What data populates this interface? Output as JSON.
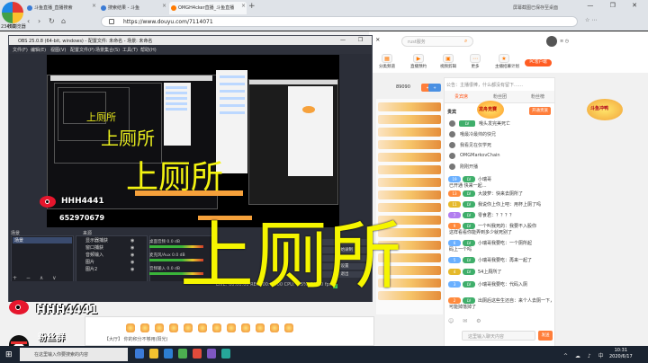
{
  "browser": {
    "logo_label": "2345浏览器",
    "tabs": [
      {
        "label": "斗鱼直播_直播搜索"
      },
      {
        "label": "搜索结果 - 斗鱼"
      },
      {
        "label": "OMGH4cker直播_斗鱼直播"
      }
    ],
    "tab_right": "屏幕截图已保存至桌面",
    "url": "https://www.douyu.com/7114071",
    "bookmark": "收藏"
  },
  "douyu": {
    "search_placeholder": "rust服务",
    "header_icons": [
      "分类",
      "直播",
      "视频",
      "更多",
      "娱乐"
    ],
    "header_icon_labels": [
      "分类频道",
      "直播预约",
      "视频剪辑",
      "更多",
      "主播招募计划"
    ],
    "pc_client": "PC客户端",
    "stream_stat": "89090",
    "widget_label": "龙舟竞赛",
    "right_banner": "斗鱼冲鸭",
    "chat_notice": "公告：主播很棒，什么都没有留下……",
    "chat_tabs": [
      "贵宾席",
      "粉丝团",
      "粉丝榜"
    ],
    "chat_open": "开通贵族",
    "chat_section": "贵宾",
    "fans": [
      {
        "level": "LV",
        "name": "哦头发完美死亡"
      },
      {
        "level": "",
        "name": "哦最冷最帅的快兄"
      },
      {
        "level": "",
        "name": "我看见在仅学死"
      },
      {
        "level": "",
        "name": "OMGMarkovChain"
      },
      {
        "level": "",
        "name": "刚刚开播"
      }
    ],
    "chat_lines": [
      {
        "b1": "19",
        "b2": "LV",
        "text": "小瑞哥",
        "cont": "已开通  快来一起…"
      },
      {
        "b1": "13",
        "b2": "LV",
        "text": "大菠萝：快来去厕所了",
        "cont": ""
      },
      {
        "b1": "11",
        "b2": "LV",
        "text": "我说你上你上吧：用杯上厕了吗",
        "cont": ""
      },
      {
        "b1": "7",
        "b2": "LV",
        "text": "零食君：？？？？",
        "cont": ""
      },
      {
        "b1": "9",
        "b2": "LV",
        "text": "一个叫我死的：我要不入股你",
        "cont": "这样看看你能弄到多少就死别了"
      },
      {
        "b1": "6",
        "b2": "LV",
        "text": "小瑞哥我要吃：一个厕所起",
        "cont": "码上一个吗"
      },
      {
        "b1": "5",
        "b2": "LV",
        "text": "小瑞哥我要吃：再来一起了",
        "cont": ""
      },
      {
        "b1": "4",
        "b2": "LV",
        "text": "54上厕所了",
        "cont": ""
      },
      {
        "b1": "3",
        "b2": "LV",
        "text": "小瑞哥我要吃：代码入厕",
        "cont": ""
      },
      {
        "b1": "2",
        "b2": "LV",
        "text": "出厕后这些生还自：来个人去厕一下，",
        "cont": "可能掉落掉了"
      }
    ],
    "chat_input_placeholder": "这里输入聊天内容",
    "chat_send": "发送",
    "bottom_text": "【大厅】 你的积分不够用(阳光)"
  },
  "obs": {
    "title": "OBS 25.0.8 (64-bit, windows) - 配置文件: 未命名 - 场景: 未命名",
    "menus": [
      "文件(F)",
      "编辑(E)",
      "视图(V)",
      "配置文件(P)",
      "场景集合(S)",
      "工具(T)",
      "帮助(H)"
    ],
    "panel_titles": [
      "场景",
      "来源",
      "音频混音器",
      "场景过渡",
      "控件"
    ],
    "scenes": [
      "场景"
    ],
    "sources": [
      "显示器捕获",
      "窗口捕获",
      "音频输入",
      "图片",
      "图片2"
    ],
    "mixer": [
      {
        "label": "桌面音频 0.0 dB"
      },
      {
        "label": "麦克风/Aux 0.0 dB"
      },
      {
        "label": "音频输入 0.0 dB"
      }
    ],
    "controls": [
      "开始推流",
      "开始录制",
      "工作室模式",
      "设置",
      "退出"
    ],
    "status": "LIVE: 00:00:00   REC: 00:00:00   CPU: 4.5%, 30.00 fps"
  },
  "overlay": {
    "big_caption": "上厕所",
    "mid_caption": "上厕所",
    "small_caption": "上厕所",
    "tiny_caption": "上厕所",
    "weibo_name": "HHH4441",
    "fans_label": "粉丝群",
    "qq_number": "652970679"
  },
  "taskbar": {
    "search": "在这里输入你要搜索的内容",
    "time": "10:31",
    "date": "2020/6/17"
  }
}
